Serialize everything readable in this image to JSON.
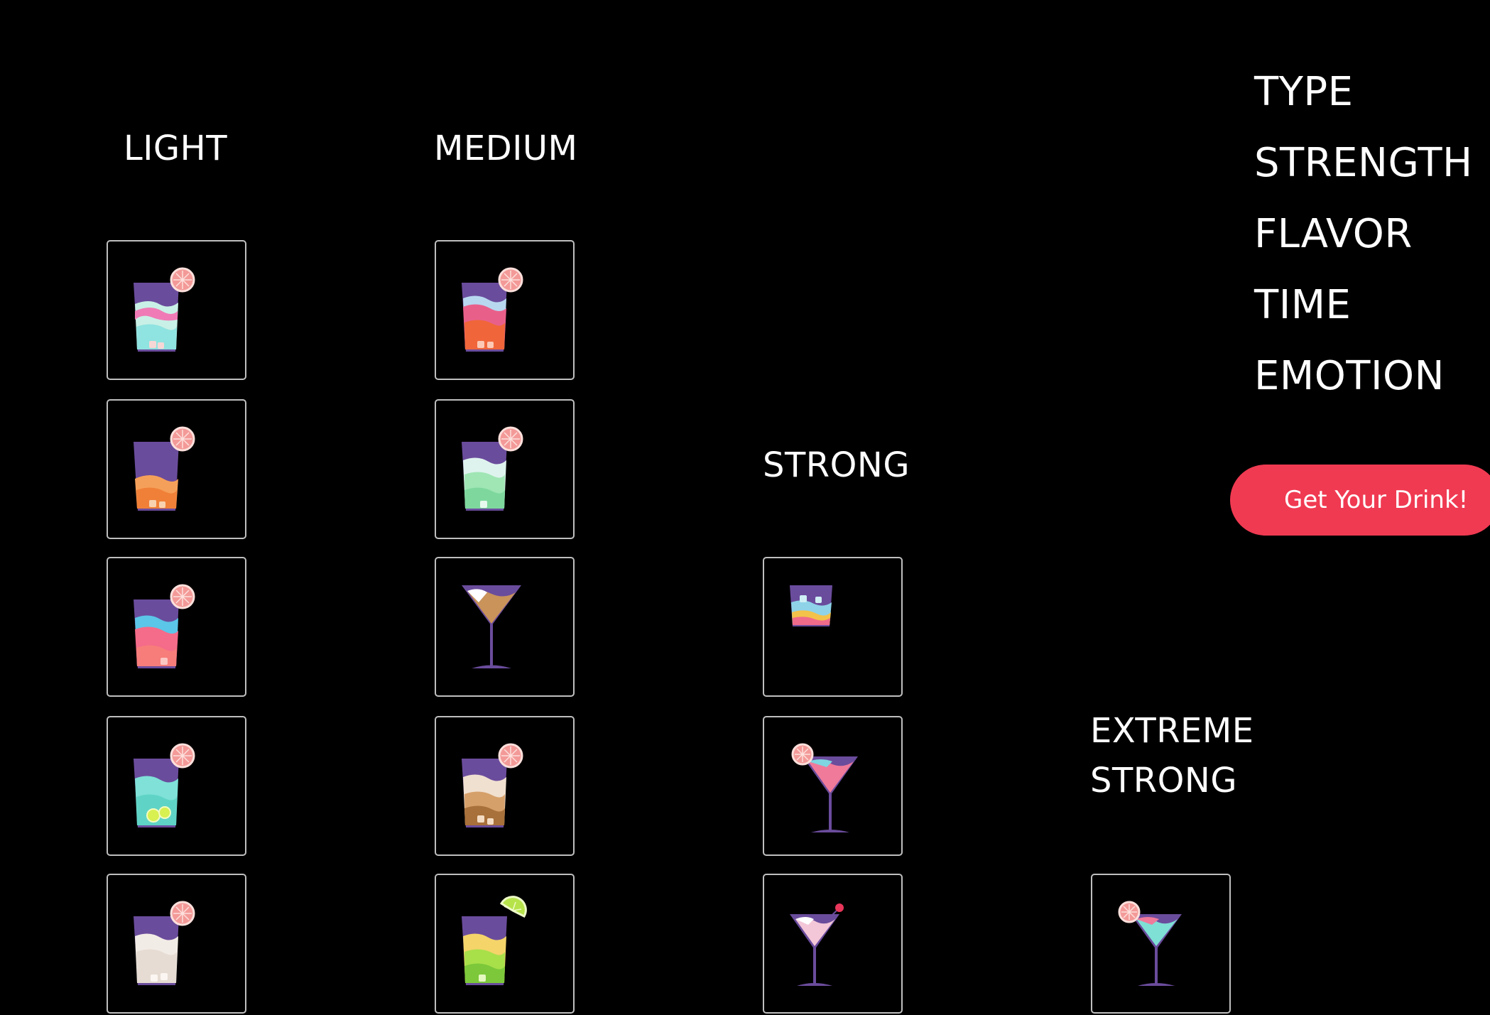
{
  "columns": {
    "light": "LIGHT",
    "medium": "MEDIUM",
    "strong": "STRONG",
    "extreme_line1": "EXTREME",
    "extreme_line2": "STRONG"
  },
  "menu": {
    "items": [
      "TYPE",
      "STRENGTH",
      "FLAVOR",
      "TIME",
      "EMOTION"
    ]
  },
  "cta_label": "Get Your Drink!",
  "colors": {
    "background": "#000000",
    "cta": "#f03a52",
    "glass": "#6a4c9c",
    "grapefruit": "#f39a98",
    "lime": "#b6e34a",
    "tile_border": "#bfbfbf"
  }
}
